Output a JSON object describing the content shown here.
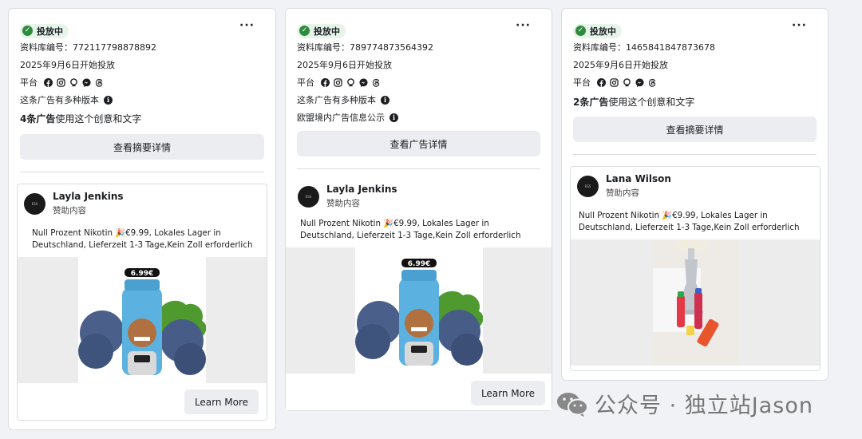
{
  "cards": [
    {
      "status": "投放中",
      "library_id": "资料库编号：772117798878892",
      "start_date": "2025年9月6日开始投放",
      "platform_label": "平台",
      "versions_text": "这条广告有多种版本",
      "usage_bold": "4条广告",
      "usage_rest": "使用这个创意和文字",
      "action_label": "查看摘要详情",
      "advertiser": "Layla Jenkins",
      "sponsored": "赞助内容",
      "ad_text": "Null Prozent Nikotin 🎉€9.99, Lokales Lager in Deutschland, Lieferzeit 1-3 Tage,Kein Zoll erforderlich",
      "price_tag": "6.99€",
      "cta": "Learn More"
    },
    {
      "status": "投放中",
      "library_id": "资料库编号：789774873564392",
      "start_date": "2025年9月6日开始投放",
      "platform_label": "平台",
      "versions_text": "这条广告有多种版本",
      "eu_text": "欧盟境内广告信息公示",
      "action_label": "查看广告详情",
      "advertiser": "Layla Jenkins",
      "sponsored": "赞助内容",
      "ad_text": "Null Prozent Nikotin 🎉€9.99, Lokales Lager in Deutschland, Lieferzeit 1-3 Tage,Kein Zoll erforderlich",
      "price_tag": "6.99€",
      "cta": "Learn More"
    },
    {
      "status": "投放中",
      "library_id": "资料库编号：1465841847873678",
      "start_date": "2025年9月6日开始投放",
      "platform_label": "平台",
      "usage_bold": "2条广告",
      "usage_rest": "使用这个创意和文字",
      "action_label": "查看摘要详情",
      "advertiser": "Lana Wilson",
      "sponsored": "赞助内容",
      "ad_text": "Null Prozent Nikotin 🎉€9.99, Lokales Lager in Deutschland, Lieferzeit 1-3 Tage,Kein Zoll erforderlich"
    }
  ],
  "platforms": [
    "facebook-icon",
    "instagram-icon",
    "audience-network-icon",
    "messenger-icon",
    "threads-icon"
  ],
  "watermark": "公众号 · 独立站Jason",
  "colors": {
    "status_bg": "#e6f4ea",
    "status_green": "#2e8b3e",
    "button_bg": "#ebedf0"
  }
}
